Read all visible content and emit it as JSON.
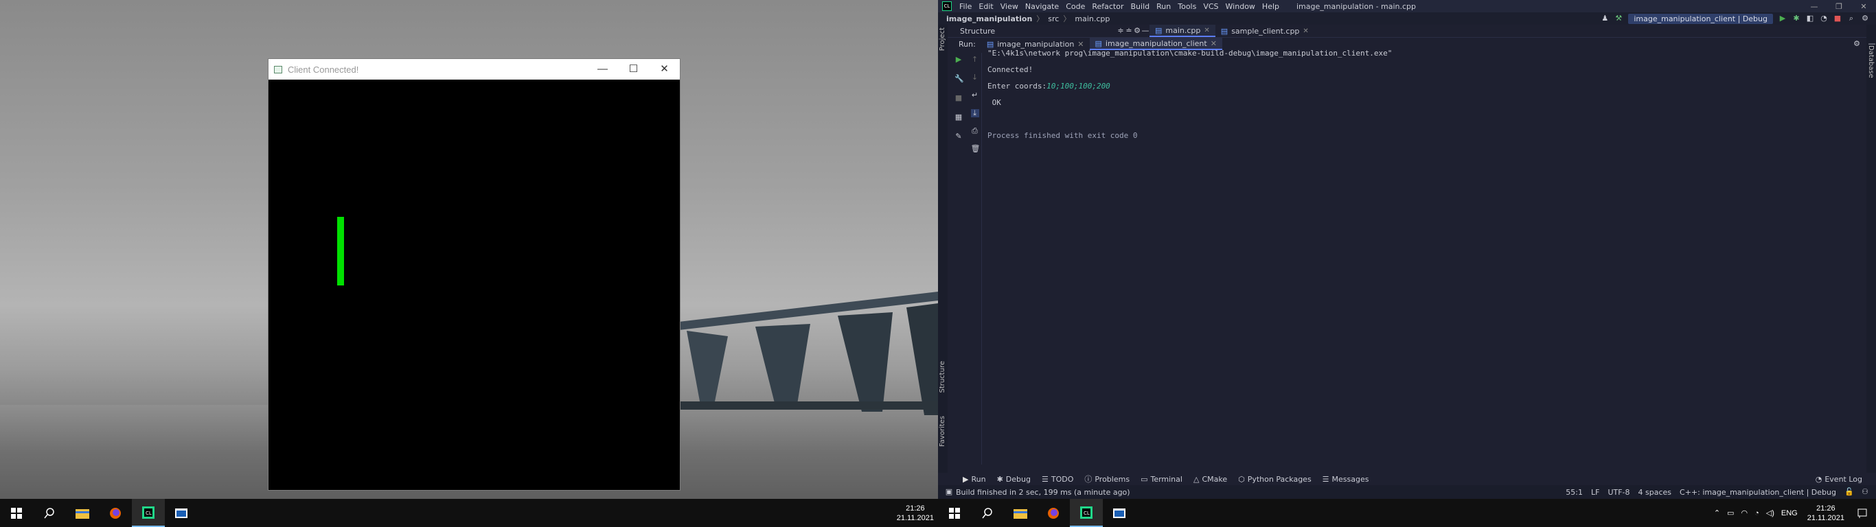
{
  "left_window": {
    "title": "Client Connected!",
    "minimize": "—",
    "maximize": "☐",
    "close": "✕",
    "bar_color": "#00e000"
  },
  "taskbar_left": {
    "time": "21:26",
    "date": "21.11.2021"
  },
  "ide": {
    "menu": [
      "File",
      "Edit",
      "View",
      "Navigate",
      "Code",
      "Refactor",
      "Build",
      "Run",
      "Tools",
      "VCS",
      "Window",
      "Help"
    ],
    "title": "image_manipulation - main.cpp",
    "breadcrumb": {
      "project": "image_manipulation",
      "folder": "src",
      "file": "main.cpp"
    },
    "run_config": "image_manipulation_client | Debug",
    "editor_tabs": [
      "main.cpp",
      "sample_client.cpp"
    ],
    "structure_label": "Structure",
    "project_label": "Project",
    "structure_side_label": "Structure",
    "favorites_label": "Favorites",
    "database_label": "Database",
    "run_label": "Run:",
    "run_tabs": [
      "image_manipulation",
      "image_manipulation_client"
    ],
    "console": {
      "command": "\"E:\\4k1s\\network prog\\image_manipulation\\cmake-build-debug\\image_manipulation_client.exe\"",
      "connected": "Connected!",
      "prompt": "Enter coords:",
      "input": "10;100;100;200",
      "ok": " OK",
      "finished": "Process finished with exit code 0"
    },
    "bottom_tools": [
      "Run",
      "Debug",
      "TODO",
      "Problems",
      "Terminal",
      "CMake",
      "Python Packages",
      "Messages"
    ],
    "event_log": "Event Log",
    "status": {
      "message": "Build finished in 2 sec, 199 ms (a minute ago)",
      "position": "55:1",
      "line_sep": "LF",
      "encoding": "UTF-8",
      "indent": "4 spaces",
      "context": "C++: image_manipulation_client | Debug"
    }
  },
  "taskbar_right": {
    "lang": "ENG",
    "time": "21:26",
    "date": "21.11.2021"
  }
}
